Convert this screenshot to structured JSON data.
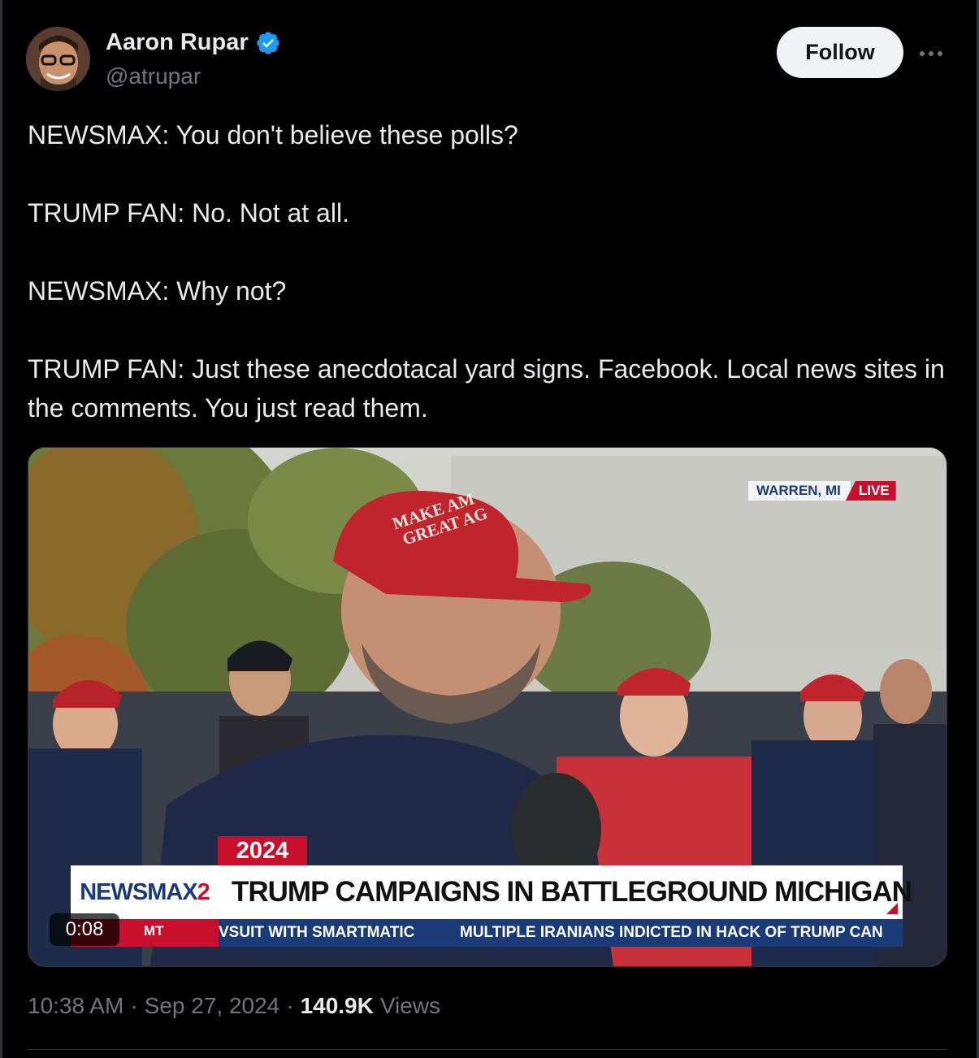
{
  "author": {
    "name": "Aaron Rupar",
    "handle": "@atrupar",
    "verified_icon": "verified-badge-icon",
    "avatar_icon": "avatar-photo"
  },
  "actions": {
    "follow_label": "Follow",
    "more_icon": "more-horizontal-icon"
  },
  "tweet": {
    "lines": [
      "NEWSMAX: You don't believe these polls?",
      "TRUMP FAN: No. Not at all.",
      "NEWSMAX: Why not?",
      "TRUMP FAN: Just these anecdotacal yard signs. Facebook. Local news sites in the comments. You just read them."
    ]
  },
  "video": {
    "duration": "0:08",
    "location": "WARREN, MI",
    "live_label": "LIVE",
    "year_tag": "2024",
    "network_logo": "NEWSMAX",
    "network_logo_suffix": "2",
    "headline": "TRUMP CAMPAIGNS IN BATTLEGROUND MICHIGAN",
    "ticker_left": "MT",
    "ticker_items": [
      "VSUIT WITH SMARTMATIC",
      "MULTIPLE IRANIANS INDICTED IN HACK OF TRUMP CAN"
    ],
    "cap_text_line1": "MAKE AM",
    "cap_text_line2": "GREAT AG"
  },
  "meta": {
    "time": "10:38 AM",
    "date": "Sep 27, 2024",
    "views_count": "140.9K",
    "views_label": "Views",
    "separator": "·"
  },
  "colors": {
    "background": "#000000",
    "text_primary": "#e7e9ea",
    "text_secondary": "#71767b",
    "verified_blue": "#1d9bf0",
    "newsmax_red": "#c8102e",
    "newsmax_blue": "#1b3a78"
  }
}
